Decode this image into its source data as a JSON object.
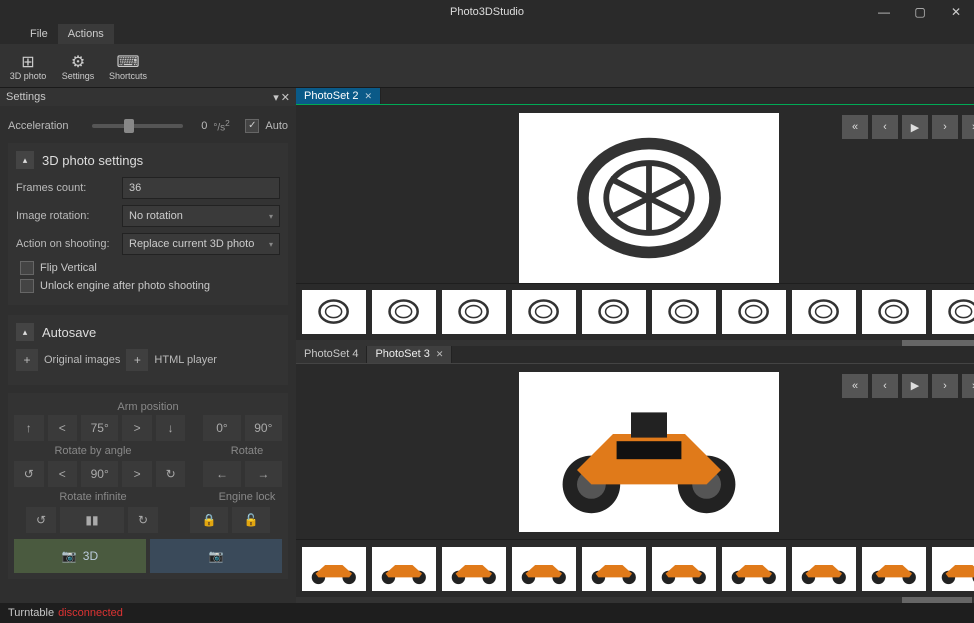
{
  "app": {
    "title": "Photo3DStudio"
  },
  "window_controls": {
    "min": "—",
    "max": "▢",
    "close": "✕"
  },
  "menu": {
    "file": "File",
    "actions": "Actions"
  },
  "ribbon": {
    "photo3d": "3D photo",
    "settings": "Settings",
    "shortcuts": "Shortcuts"
  },
  "settings_pane": {
    "title": "Settings"
  },
  "accel": {
    "label": "Acceleration",
    "value": "0",
    "unit": "°/s",
    "sq": "2",
    "auto": "Auto"
  },
  "sec3d": {
    "title": "3D photo settings",
    "frames_label": "Frames count:",
    "frames_value": "36",
    "rot_label": "Image rotation:",
    "rot_value": "No rotation",
    "act_label": "Action on shooting:",
    "act_value": "Replace current 3D photo",
    "flip": "Flip Vertical",
    "unlock": "Unlock engine after photo shooting"
  },
  "autosave": {
    "title": "Autosave",
    "orig": "Original images",
    "html": "HTML player"
  },
  "arm": {
    "pos": "Arm position",
    "angle": "75°",
    "z": "0°",
    "n": "90°",
    "rotby": "Rotate by angle",
    "rot": "Rotate",
    "rangle": "90°",
    "inf": "Rotate infinite",
    "lock": "Engine lock",
    "d3": "3D"
  },
  "tabs_top": {
    "t1": "PhotoSet 2"
  },
  "tabs_bot": {
    "t1": "PhotoSet 4",
    "t2": "PhotoSet 3"
  },
  "nav": {
    "first": "«",
    "prev": "‹",
    "play": "▶",
    "next": "›",
    "last": "»"
  },
  "status": {
    "label": "Turntable",
    "state": "disconnected"
  },
  "chart_data": null
}
